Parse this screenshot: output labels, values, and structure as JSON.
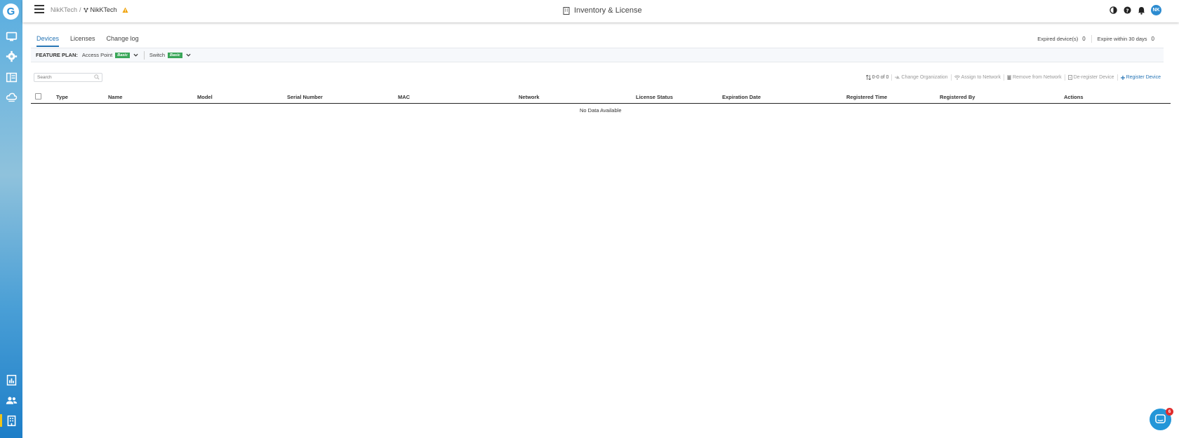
{
  "header": {
    "breadcrumb_org": "NikKTech",
    "breadcrumb_sep": "/",
    "breadcrumb_site": "NikKTech",
    "title": "Inventory & License",
    "avatar_initials": "NK"
  },
  "tabs": [
    {
      "label": "Devices",
      "active": true
    },
    {
      "label": "Licenses",
      "active": false
    },
    {
      "label": "Change log",
      "active": false
    }
  ],
  "stats": {
    "expired_label": "Expired device(s)",
    "expired_count": "0",
    "expire30_label": "Expire within 30 days",
    "expire30_count": "0"
  },
  "feature_plan": {
    "label": "FEATURE PLAN:",
    "items": [
      {
        "name": "Access Point",
        "badge": "Basic"
      },
      {
        "name": "Switch",
        "badge": "Basic"
      }
    ]
  },
  "search": {
    "placeholder": "Search"
  },
  "toolbar": {
    "pager": "0-0 of 0",
    "change_org": "Change Organization",
    "assign": "Assign to Network",
    "remove": "Remove from Network",
    "deregister": "De-register Device",
    "register": "Register Device"
  },
  "table": {
    "columns": [
      "Type",
      "Name",
      "Model",
      "Serial Number",
      "MAC",
      "Network",
      "License Status",
      "Expiration Date",
      "Registered Time",
      "Registered By",
      "Actions"
    ],
    "empty_text": "No Data Available"
  },
  "chat": {
    "badge_count": "6"
  },
  "colors": {
    "accent": "#2775b5",
    "badge_green": "#3aa659",
    "warning": "#f0a30a",
    "rail_active": "#f0c419"
  }
}
